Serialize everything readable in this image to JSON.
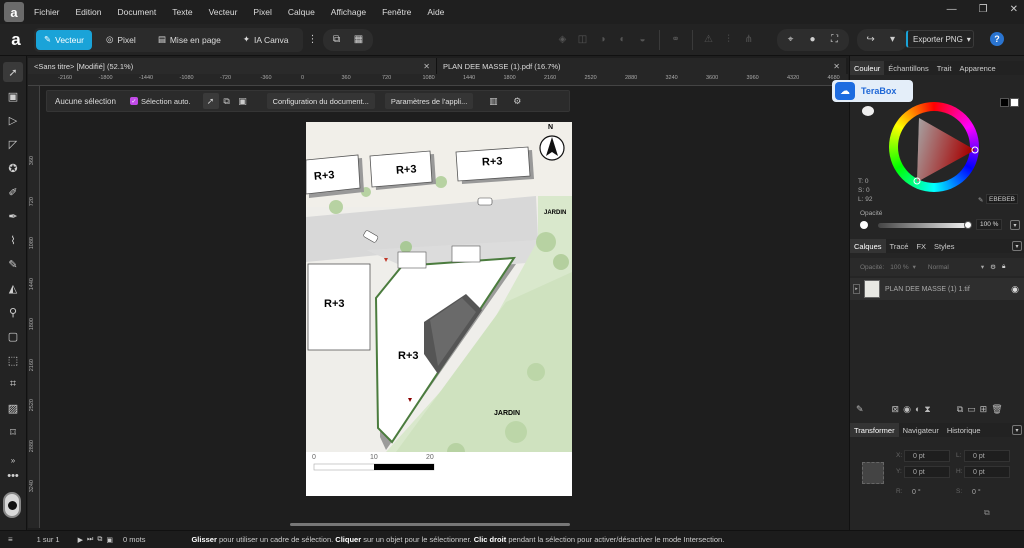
{
  "menubar": {
    "items": [
      "Fichier",
      "Edition",
      "Document",
      "Texte",
      "Vecteur",
      "Pixel",
      "Calque",
      "Affichage",
      "Fenêtre",
      "Aide"
    ]
  },
  "toolbar": {
    "personas": [
      "Vecteur",
      "Pixel",
      "Mise en page",
      "IA Canva"
    ],
    "export_label": "Exporter PNG"
  },
  "tabs": [
    {
      "label": "<Sans titre> [Modifié] (52.1%)"
    },
    {
      "label": "PLAN DEE MASSE (1).pdf (16.7%)"
    }
  ],
  "ruler": {
    "h_labels": [
      "-2160",
      "-1800",
      "-1440",
      "-1080",
      "-720",
      "-360",
      "0",
      "360",
      "720",
      "1080",
      "1440",
      "1800",
      "2160",
      "2520",
      "2880",
      "3240",
      "3600",
      "3960",
      "4320",
      "4680"
    ],
    "v_labels": [
      "360",
      "720",
      "1080",
      "1440",
      "1800",
      "2160",
      "2520",
      "2880",
      "3240"
    ]
  },
  "context": {
    "selection": "Aucune sélection",
    "auto_select": "Sélection auto.",
    "doc_config": "Configuration du document...",
    "app_params": "Paramètres de l'appli..."
  },
  "plan": {
    "buildings": [
      "R+3",
      "R+3",
      "R+3",
      "R+3",
      "R+3"
    ],
    "garden_labels": [
      "JARDIN",
      "JARDIN"
    ],
    "north": "N",
    "scale_labels": [
      "0",
      "10",
      "20"
    ]
  },
  "color_panel": {
    "tabs": [
      "Couleur",
      "Échantillons",
      "Trait",
      "Apparence"
    ],
    "t": "T: 0",
    "s": "S: 0",
    "l": "L: 92",
    "hex": "EBEBEB",
    "opacity_label": "Opacité",
    "opacity_value": "100 %"
  },
  "terabox": {
    "label": "TeraBox"
  },
  "layers_panel": {
    "tabs": [
      "Calques",
      "Tracé",
      "FX",
      "Styles"
    ],
    "opacity_label": "Opacité:",
    "opacity_value": "100 %",
    "blend": "Normal",
    "layer_name": "PLAN DEE MASSE (1) 1.tif"
  },
  "transform_panel": {
    "tabs": [
      "Transformer",
      "Navigateur",
      "Historique"
    ],
    "x": "0 pt",
    "y": "0 pt",
    "l": "0 pt",
    "h": "0 pt",
    "r": "0 °",
    "s": "0 °",
    "x_label": "X:",
    "y_label": "Y:",
    "l_label": "L:",
    "h_label": "H:",
    "r_label": "R:",
    "s_label": "S:"
  },
  "status": {
    "page": "1 sur 1",
    "words": "0 mots",
    "hint_b1": "Glisser",
    "hint_t1": " pour utiliser un cadre de sélection. ",
    "hint_b2": "Cliquer",
    "hint_t2": " sur un objet pour le sélectionner. ",
    "hint_b3": "Clic droit",
    "hint_t3": " pendant la sélection pour activer/désactiver le mode Intersection."
  }
}
